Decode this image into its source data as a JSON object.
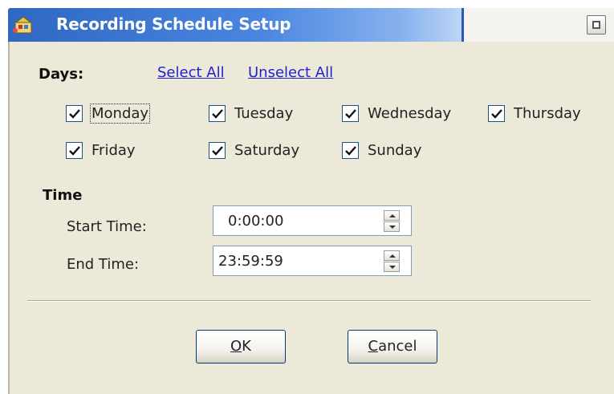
{
  "window": {
    "title": "Recording Schedule Setup",
    "title_icon": "app-icon",
    "restore_icon": "restore-icon"
  },
  "days": {
    "label": "Days:",
    "select_all": "Select All",
    "unselect_all": "Unselect All",
    "items": [
      {
        "label": "Monday",
        "checked": true,
        "focused": true
      },
      {
        "label": "Tuesday",
        "checked": true
      },
      {
        "label": "Wednesday",
        "checked": true
      },
      {
        "label": "Thursday",
        "checked": true
      },
      {
        "label": "Friday",
        "checked": true
      },
      {
        "label": "Saturday",
        "checked": true
      },
      {
        "label": "Sunday",
        "checked": true
      }
    ]
  },
  "time": {
    "label": "Time",
    "start_label": "Start Time:",
    "start_value": "0:00:00",
    "end_label": "End Time:",
    "end_value": "23:59:59"
  },
  "buttons": {
    "ok_mnemonic": "O",
    "ok_rest": "K",
    "cancel_mnemonic": "C",
    "cancel_rest": "ancel"
  },
  "colors": {
    "titlebar": "#2f67c2",
    "dialog_bg": "#ece9d8",
    "link": "#2222cc"
  }
}
